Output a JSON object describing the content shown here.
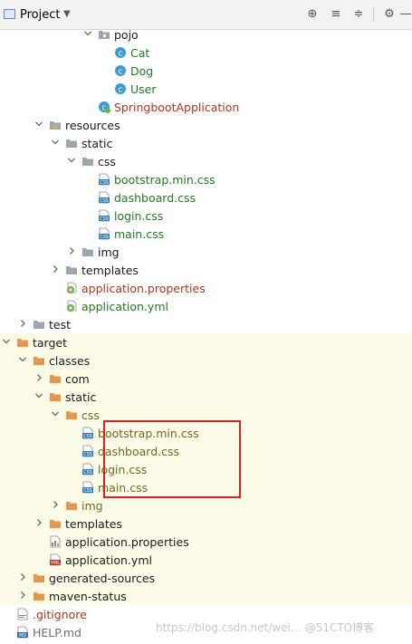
{
  "toolbar": {
    "title": "Project",
    "buttons": [
      {
        "name": "locate-icon",
        "glyph": "⊕"
      },
      {
        "name": "expand-all-icon",
        "glyph": "≡"
      },
      {
        "name": "collapse-all-icon",
        "glyph": "≑"
      },
      {
        "name": "settings-gear-icon",
        "glyph": "⚙"
      },
      {
        "name": "hide-panel-icon",
        "glyph": "—"
      }
    ]
  },
  "tree": [
    {
      "label": "pojo",
      "level": 6,
      "arrow": "down",
      "icon": "package",
      "color": "default"
    },
    {
      "label": "Cat",
      "level": 7,
      "arrow": "none",
      "icon": "class",
      "color": "green"
    },
    {
      "label": "Dog",
      "level": 7,
      "arrow": "none",
      "icon": "class",
      "color": "green"
    },
    {
      "label": "User",
      "level": 7,
      "arrow": "none",
      "icon": "class",
      "color": "green"
    },
    {
      "label": "SpringbootApplication",
      "level": 6,
      "arrow": "none",
      "icon": "spring-class",
      "color": "red"
    },
    {
      "label": "resources",
      "level": 3,
      "arrow": "down",
      "icon": "resources-folder",
      "color": "default"
    },
    {
      "label": "static",
      "level": 4,
      "arrow": "down",
      "icon": "folder",
      "color": "default"
    },
    {
      "label": "css",
      "level": 5,
      "arrow": "down",
      "icon": "folder",
      "color": "default"
    },
    {
      "label": "bootstrap.min.css",
      "level": 6,
      "arrow": "none",
      "icon": "css-file",
      "color": "green"
    },
    {
      "label": "dashboard.css",
      "level": 6,
      "arrow": "none",
      "icon": "css-file",
      "color": "green"
    },
    {
      "label": "login.css",
      "level": 6,
      "arrow": "none",
      "icon": "css-file",
      "color": "green"
    },
    {
      "label": "main.css",
      "level": 6,
      "arrow": "none",
      "icon": "css-file",
      "color": "green"
    },
    {
      "label": "img",
      "level": 5,
      "arrow": "right",
      "icon": "folder",
      "color": "default"
    },
    {
      "label": "templates",
      "level": 4,
      "arrow": "right",
      "icon": "folder",
      "color": "default"
    },
    {
      "label": "application.properties",
      "level": 4,
      "arrow": "none",
      "icon": "spring-config",
      "color": "red"
    },
    {
      "label": "application.yml",
      "level": 4,
      "arrow": "none",
      "icon": "spring-config",
      "color": "green"
    },
    {
      "label": "test",
      "level": 2,
      "arrow": "right",
      "icon": "folder",
      "color": "default"
    },
    {
      "label": "target",
      "level": 1,
      "arrow": "down",
      "icon": "orange-folder",
      "color": "default",
      "hl": true
    },
    {
      "label": "classes",
      "level": 2,
      "arrow": "down",
      "icon": "orange-folder",
      "color": "default",
      "hl": true
    },
    {
      "label": "com",
      "level": 3,
      "arrow": "right",
      "icon": "orange-folder",
      "color": "default",
      "hl": true
    },
    {
      "label": "static",
      "level": 3,
      "arrow": "down",
      "icon": "orange-folder",
      "color": "default",
      "hl": true
    },
    {
      "label": "css",
      "level": 4,
      "arrow": "down",
      "icon": "orange-folder",
      "color": "olive",
      "hl": true
    },
    {
      "label": "bootstrap.min.css",
      "level": 5,
      "arrow": "none",
      "icon": "css-file",
      "color": "olive",
      "hl": true
    },
    {
      "label": "dashboard.css",
      "level": 5,
      "arrow": "none",
      "icon": "css-file",
      "color": "olive",
      "hl": true
    },
    {
      "label": "login.css",
      "level": 5,
      "arrow": "none",
      "icon": "css-file",
      "color": "olive",
      "hl": true
    },
    {
      "label": "main.css",
      "level": 5,
      "arrow": "none",
      "icon": "css-file",
      "color": "olive",
      "hl": true
    },
    {
      "label": "img",
      "level": 4,
      "arrow": "right",
      "icon": "orange-folder",
      "color": "olive",
      "hl": true
    },
    {
      "label": "templates",
      "level": 3,
      "arrow": "right",
      "icon": "orange-folder",
      "color": "default",
      "hl": true
    },
    {
      "label": "application.properties",
      "level": 3,
      "arrow": "none",
      "icon": "properties-file",
      "color": "default",
      "hl": true
    },
    {
      "label": "application.yml",
      "level": 3,
      "arrow": "none",
      "icon": "yml-file",
      "color": "default",
      "hl": true
    },
    {
      "label": "generated-sources",
      "level": 2,
      "arrow": "right",
      "icon": "orange-folder",
      "color": "default",
      "hl": true
    },
    {
      "label": "maven-status",
      "level": 2,
      "arrow": "right",
      "icon": "orange-folder",
      "color": "default",
      "hl": true
    },
    {
      "label": ".gitignore",
      "level": 1,
      "arrow": "none",
      "icon": "gitignore-file",
      "color": "red"
    },
    {
      "label": "HELP.md",
      "level": 1,
      "arrow": "none",
      "icon": "md-file",
      "color": "dim"
    }
  ],
  "watermark": "https://blog.csdn.net/wei… @51CTO博客",
  "colors": {
    "green": "#1e7a1e",
    "red": "#b0361b",
    "olive": "#6b6b20",
    "highlight_row": "#fbfbe8",
    "annotation_box": "#e02020"
  }
}
